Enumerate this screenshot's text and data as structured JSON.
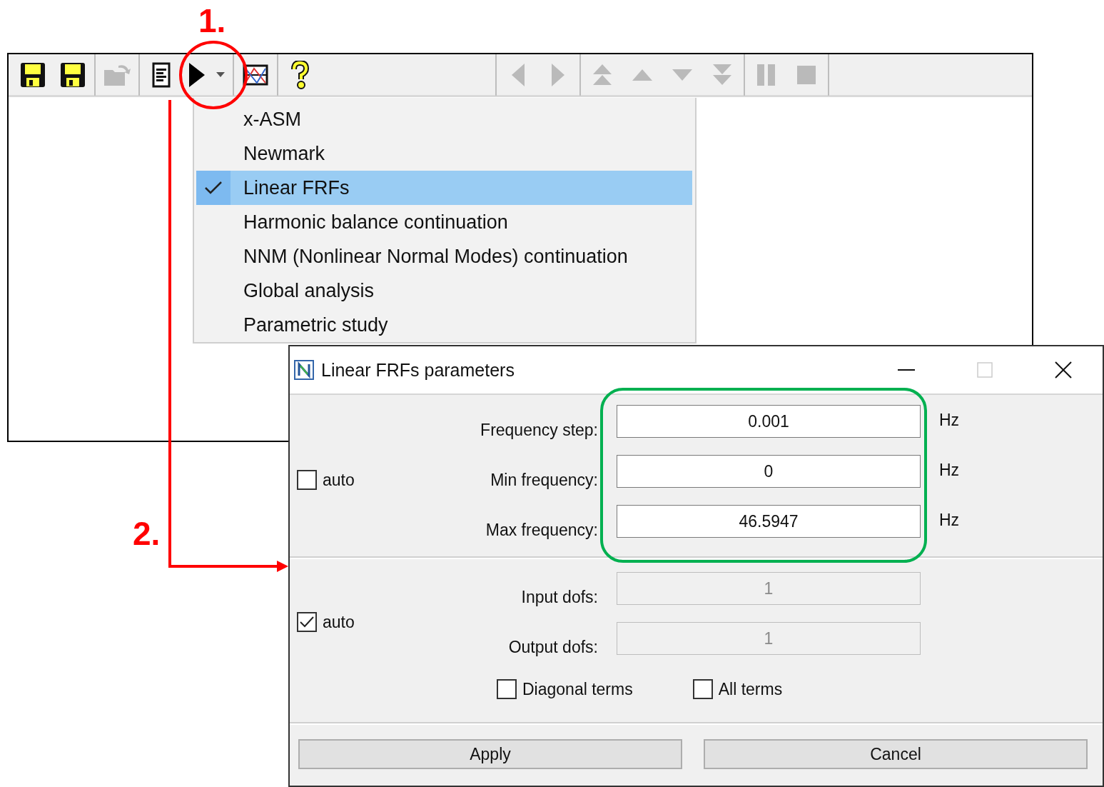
{
  "toolbar": {
    "buttons": [
      {
        "kind": "save",
        "disabled": false
      },
      {
        "kind": "save-as",
        "disabled": false
      },
      {
        "kind": "separator"
      },
      {
        "kind": "open",
        "disabled": true
      },
      {
        "kind": "separator"
      },
      {
        "kind": "document",
        "disabled": false
      },
      {
        "kind": "run",
        "disabled": false
      },
      {
        "kind": "separator"
      },
      {
        "kind": "chart",
        "disabled": false
      },
      {
        "kind": "separator"
      },
      {
        "kind": "help",
        "disabled": false
      },
      {
        "kind": "spacer"
      },
      {
        "kind": "separator"
      },
      {
        "kind": "previous",
        "disabled": true
      },
      {
        "kind": "next",
        "disabled": true
      },
      {
        "kind": "separator"
      },
      {
        "kind": "first",
        "disabled": true
      },
      {
        "kind": "up",
        "disabled": true
      },
      {
        "kind": "down",
        "disabled": true
      },
      {
        "kind": "last",
        "disabled": true
      },
      {
        "kind": "separator"
      },
      {
        "kind": "pause",
        "disabled": true
      },
      {
        "kind": "stop",
        "disabled": true
      },
      {
        "kind": "separator"
      }
    ]
  },
  "menu": {
    "items": [
      {
        "label": "x-ASM",
        "checked": false,
        "selected": false
      },
      {
        "label": "Newmark",
        "checked": false,
        "selected": false
      },
      {
        "label": "Linear FRFs",
        "checked": true,
        "selected": true
      },
      {
        "label": "Harmonic balance continuation",
        "checked": false,
        "selected": false
      },
      {
        "label": "NNM (Nonlinear Normal Modes) continuation",
        "checked": false,
        "selected": false
      },
      {
        "label": "Global analysis",
        "checked": false,
        "selected": false
      },
      {
        "label": "Parametric study",
        "checked": false,
        "selected": false
      }
    ]
  },
  "dialog": {
    "title": "Linear FRFs parameters",
    "maximize_disabled": true,
    "sections": [
      {
        "auto": {
          "label": "auto",
          "checked": false
        },
        "fields": [
          {
            "label": "Frequency step:",
            "value": "0.001",
            "unit": "Hz",
            "disabled": false
          },
          {
            "label": "Min frequency:",
            "value": "0",
            "unit": "Hz",
            "disabled": false
          },
          {
            "label": "Max frequency:",
            "value": "46.5947",
            "unit": "Hz",
            "disabled": false
          }
        ]
      },
      {
        "auto": {
          "label": "auto",
          "checked": true
        },
        "fields": [
          {
            "label": "Input dofs:",
            "value": "1",
            "disabled": true
          },
          {
            "label": "Output dofs:",
            "value": "1",
            "disabled": true
          }
        ],
        "options": [
          {
            "label": "Diagonal terms",
            "checked": false
          },
          {
            "label": "All terms",
            "checked": false
          }
        ]
      }
    ],
    "buttons": [
      "Apply",
      "Cancel"
    ]
  },
  "annotations": [
    {
      "label": "1."
    },
    {
      "label": "2."
    }
  ]
}
